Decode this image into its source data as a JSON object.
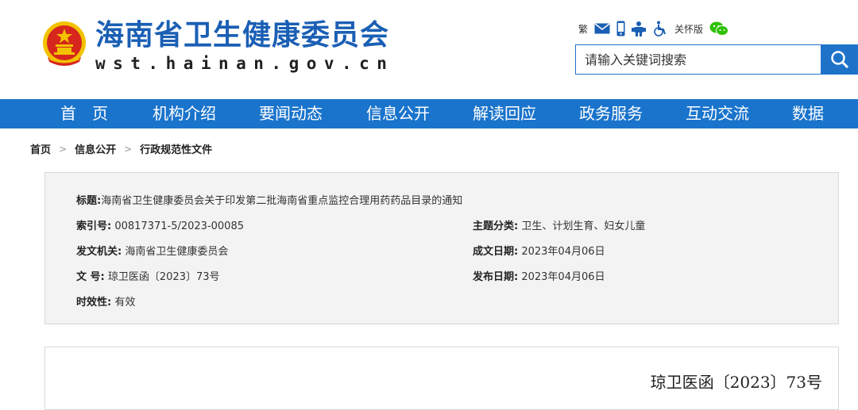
{
  "header": {
    "title": "海南省卫生健康委员会",
    "domain": "wst.hainan.gov.cn",
    "tools": {
      "traditional": "繁",
      "care_mode": "关怀版"
    },
    "search": {
      "placeholder": "请输入关键词搜索"
    }
  },
  "nav": {
    "items": [
      "首　页",
      "机构介绍",
      "要闻动态",
      "信息公开",
      "解读回应",
      "政务服务",
      "互动交流",
      "数据"
    ]
  },
  "breadcrumb": [
    "首页",
    "信息公开",
    "行政规范性文件"
  ],
  "breadcrumb_sep": ">",
  "meta": {
    "title_label": "标题:",
    "title_value": "海南省卫生健康委员会关于印发第二批海南省重点监控合理用药药品目录的通知",
    "index_label": "索引号:",
    "index_value": "00817371-5/2023-00085",
    "topic_label": "主题分类:",
    "topic_value": "卫生、计划生育、妇女儿童",
    "issuer_label": "发文机关:",
    "issuer_value": "海南省卫生健康委员会",
    "written_label": "成文日期:",
    "written_value": "2023年04月06日",
    "docno_label": "文 号:",
    "docno_value": "琼卫医函〔2023〕73号",
    "published_label": "发布日期:",
    "published_value": "2023年04月06日",
    "validity_label": "时效性:",
    "validity_value": "有效"
  },
  "content": {
    "doc_number": "琼卫医函〔2023〕73号"
  },
  "colors": {
    "brand_blue": "#1a74cc",
    "title_blue": "#1a5fb4",
    "emblem_red": "#d7261e",
    "emblem_gold": "#f2c200",
    "wechat_green": "#2dc100"
  }
}
